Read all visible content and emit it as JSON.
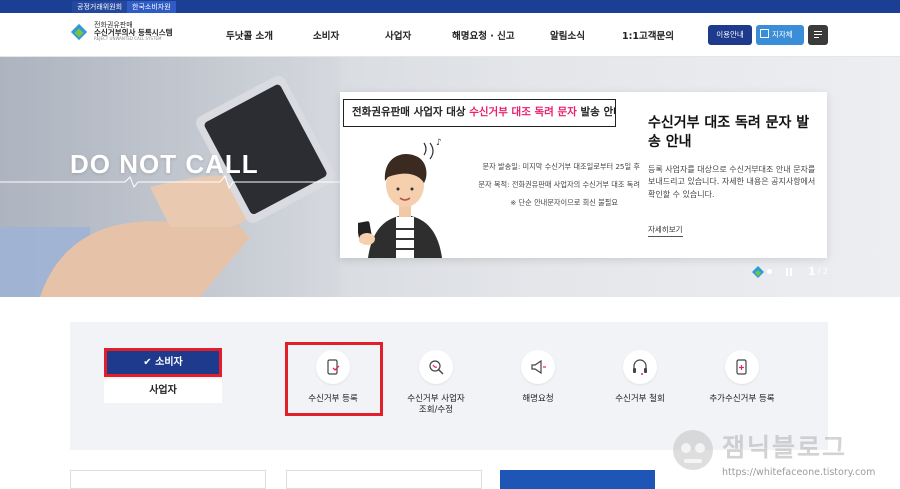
{
  "utilbar": {
    "tab1": "공정거래위원회",
    "tab2": "한국소비자원"
  },
  "logo": {
    "line1": "전화권유판매",
    "line2": "수신거부의사 등록시스템",
    "line3": "REJECT UNWANTED CALL SYSTEM"
  },
  "nav": [
    "두낫콜 소개",
    "소비자",
    "사업자",
    "해명요청 · 신고",
    "알림소식",
    "1:1고객문의"
  ],
  "header_buttons": {
    "usage": "이용안내",
    "jiji": "지자체"
  },
  "hero": {
    "headline": "DO NOT CALL",
    "notice_title_prefix": "전화권유판매 사업자 대상 ",
    "notice_title_highlight": "수신거부 대조 독려 문자",
    "notice_title_suffix": " 발송 안내",
    "notice_lines": [
      "문자 발송일: 미지막 수신거부 대조일로부터 25일 후",
      "문자 목적: 전화권유판매 사업자의 수신거부 대조 독려",
      "※ 단순 안내문자이므로 회신 불필요"
    ],
    "card_title": "수신거부 대조 독려 문자 발송 안내",
    "card_body": "등록 사업자를 대상으로 수신거부대조 안내 문자를 보내드리고 있습니다. 자세한 내용은 공지사항에서 확인할 수 있습니다.",
    "card_more": "자세히보기",
    "slide_current": "1",
    "slide_total": "/ 2"
  },
  "quick": {
    "tab_consumer": "소비자",
    "tab_business": "사업자",
    "items": [
      {
        "label": "수신거부 등록",
        "icon": "phone-register-icon"
      },
      {
        "label": "수신거부 사업자 조회/수정",
        "icon": "search-phone-icon"
      },
      {
        "label": "해명요청",
        "icon": "megaphone-icon"
      },
      {
        "label": "수신거부 철회",
        "icon": "headset-icon"
      },
      {
        "label": "추가수신거부 등록",
        "icon": "phone-add-icon"
      }
    ]
  },
  "watermark": {
    "text": "잼닉블로그",
    "url": "https://whitefaceone.tistory.com"
  },
  "colors": {
    "navy": "#1e3a8c",
    "accent_red": "#e21e2b",
    "pink": "#e8216c",
    "sky": "#3a8ed8"
  }
}
